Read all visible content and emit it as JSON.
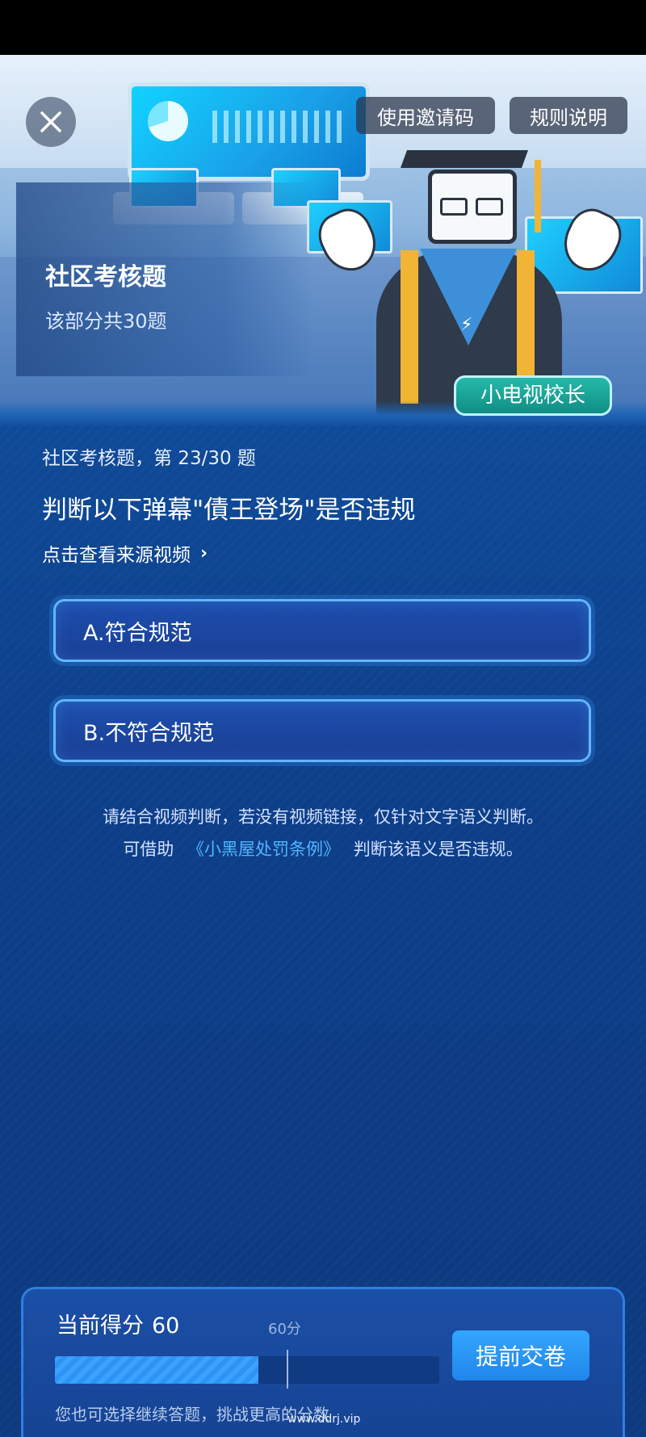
{
  "header": {
    "close_icon": "close-icon",
    "invite_code_label": "使用邀请码",
    "rules_label": "规则说明"
  },
  "hero": {
    "title": "社区考核题",
    "subtitle": "该部分共30题",
    "badge": "小电视校长"
  },
  "question": {
    "progress": "社区考核题，第 23/30 题",
    "text": "判断以下弹幕\"債王登场\"是否违规",
    "source_link": "点击查看来源视频",
    "source_link_icon": "chevron-right-icon",
    "options": [
      {
        "label": "A.符合规范"
      },
      {
        "label": "B.不符合规范"
      }
    ],
    "hint_line1": "请结合视频判断，若没有视频链接，仅针对文字语义判断。",
    "hint_line2_prefix": "可借助",
    "hint_link": "《小黑屋处罚条例》",
    "hint_line2_suffix": "判断该语义是否违规。"
  },
  "score": {
    "label": "当前得分",
    "value": "60",
    "threshold_label": "60分",
    "progress_fraction": 0.53,
    "submit_label": "提前交卷",
    "continue_hint": "您也可选择继续答题，挑战更高的分数"
  },
  "watermark": "www.ddrj.vip",
  "colors": {
    "background": "#0d3d86",
    "option_border": "#62b6ff",
    "link": "#4fb6ff",
    "button": "#2a97f7",
    "badge": "#1aa397"
  }
}
